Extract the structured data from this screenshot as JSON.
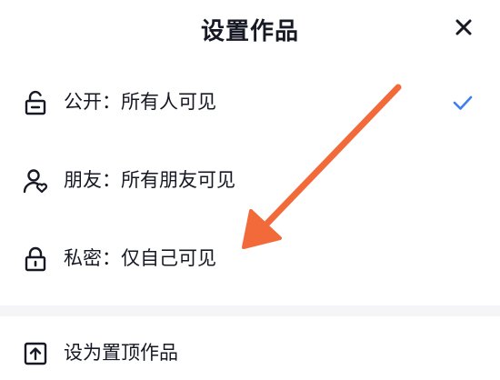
{
  "header": {
    "title": "设置作品",
    "close_icon": "close-icon"
  },
  "visibility_options": [
    {
      "label": "公开：所有人可见",
      "icon": "lock-open-icon",
      "selected": true
    },
    {
      "label": "朋友：所有朋友可见",
      "icon": "friends-icon",
      "selected": false
    },
    {
      "label": "私密：仅自己可见",
      "icon": "lock-closed-icon",
      "selected": false
    }
  ],
  "actions": [
    {
      "label": "设为置顶作品",
      "icon": "pin-top-icon"
    }
  ],
  "colors": {
    "check": "#3d7ef0",
    "annotation_arrow": "#f36a3a",
    "text": "#161823",
    "divider": "#f5f5f7"
  }
}
